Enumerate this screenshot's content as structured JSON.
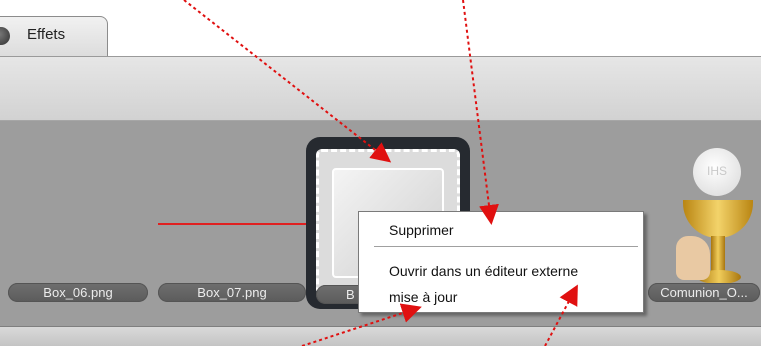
{
  "tab": {
    "label": "Effets"
  },
  "filmstrip": {
    "thumbnails": [
      {
        "label": "Box_06.png"
      },
      {
        "label": "Box_07.png"
      },
      {
        "label": "B"
      },
      {
        "label": "Comunion_O..."
      }
    ],
    "host_mark": "IHS"
  },
  "context_menu": {
    "items": [
      {
        "label": "Supprimer"
      },
      {
        "label": "Ouvrir dans un éditeur externe"
      },
      {
        "label": "mise à jour"
      }
    ]
  },
  "colors": {
    "callout_arrow": "#e01010",
    "filmstrip_bg": "#9d9d9d",
    "selection_frame": "#262a30"
  },
  "icons": [
    "tab-effects-icon",
    "arrow-callout-icon"
  ]
}
